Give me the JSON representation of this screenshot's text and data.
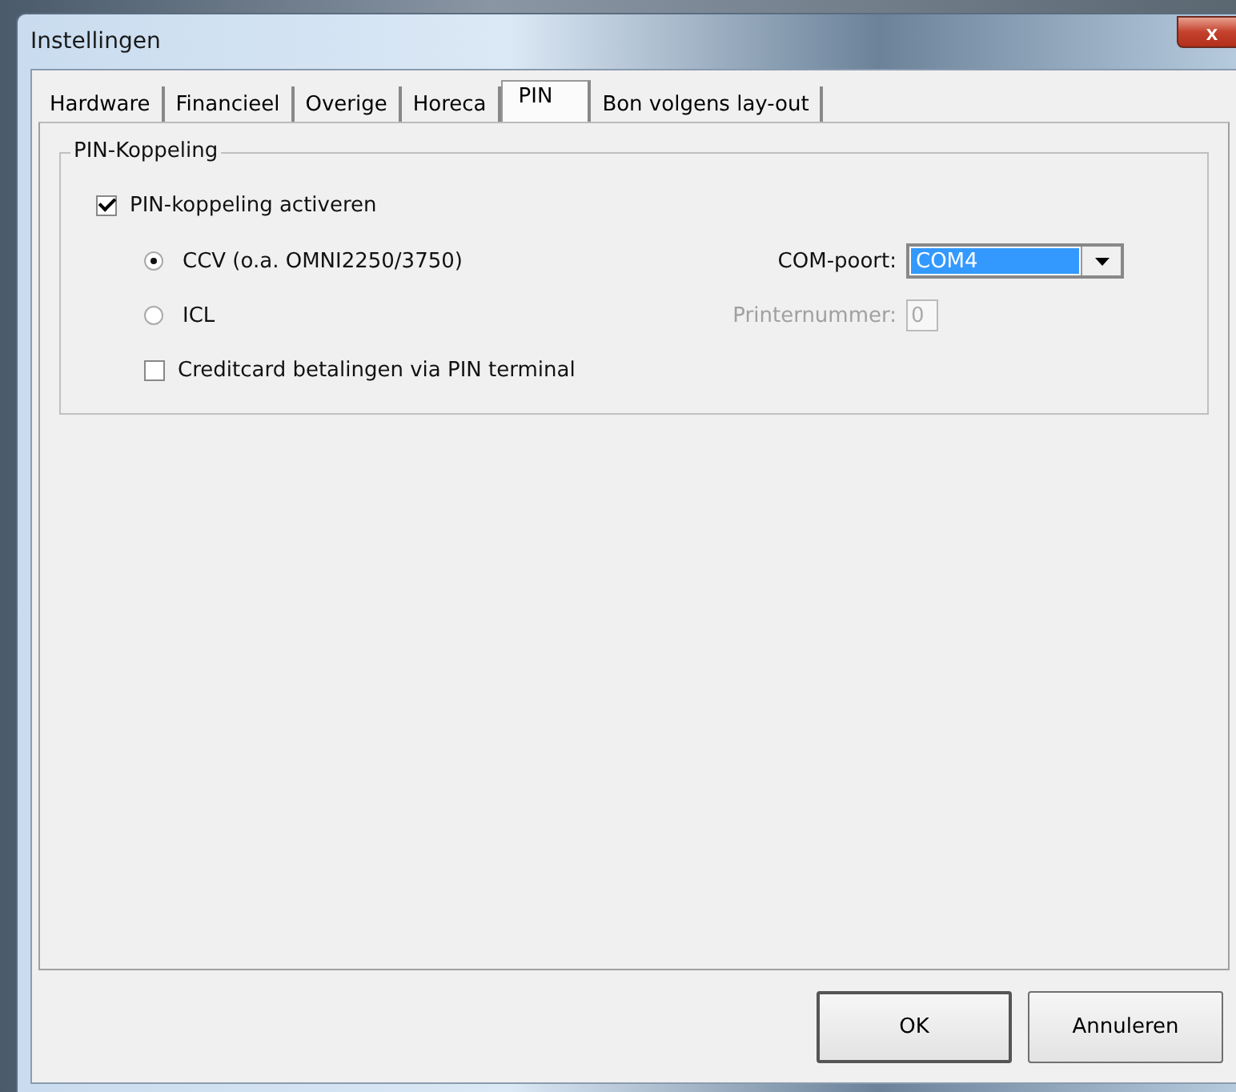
{
  "window": {
    "title": "Instellingen",
    "close": "x"
  },
  "tabs": [
    {
      "label": "Hardware",
      "selected": false
    },
    {
      "label": "Financieel",
      "selected": false
    },
    {
      "label": "Overige",
      "selected": false
    },
    {
      "label": "Horeca",
      "selected": false
    },
    {
      "label": "PIN",
      "selected": true
    },
    {
      "label": "Bon volgens lay-out",
      "selected": false
    }
  ],
  "group": {
    "title": "PIN-Koppeling",
    "enable": {
      "label": "PIN-koppeling activeren",
      "checked": true
    },
    "options": [
      {
        "label": "CCV (o.a. OMNI2250/3750)",
        "selected": true
      },
      {
        "label": "ICL",
        "selected": false
      }
    ],
    "creditcard": {
      "label": "Creditcard betalingen via PIN terminal",
      "checked": false
    },
    "com_port": {
      "label": "COM-poort:",
      "value": "COM4",
      "disabled": false
    },
    "printer": {
      "label": "Printernummer:",
      "value": "0",
      "disabled": true
    }
  },
  "buttons": [
    "OK",
    "Annuleren"
  ]
}
